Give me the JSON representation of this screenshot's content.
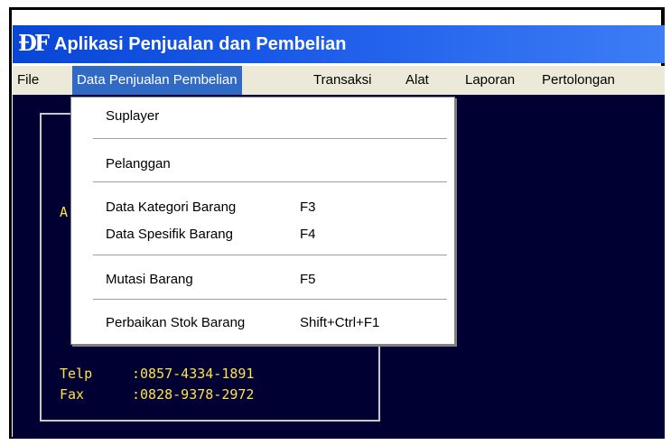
{
  "window": {
    "icon_glyph": "ÐF",
    "title": "Aplikasi Penjualan dan Pembelian"
  },
  "menubar": {
    "items": [
      {
        "label": "File"
      },
      {
        "label": "Data Penjualan Pembelian"
      },
      {
        "label": "Transaksi"
      },
      {
        "label": "Alat"
      },
      {
        "label": "Laporan"
      },
      {
        "label": "Pertolongan"
      }
    ],
    "active_index": 1
  },
  "dropdown": {
    "items": [
      {
        "label": "Suplayer",
        "shortcut": ""
      },
      {
        "label": "Pelanggan",
        "shortcut": ""
      },
      {
        "label": "Data Kategori Barang",
        "shortcut": "F3"
      },
      {
        "label": "Data Spesifik Barang",
        "shortcut": "F4"
      },
      {
        "label": "Mutasi Barang",
        "shortcut": "F5"
      },
      {
        "label": "Perbaikan Stok Barang",
        "shortcut": "Shift+Ctrl+F1"
      }
    ]
  },
  "info_panel": {
    "partial_text": "A",
    "telp_label": "Telp",
    "telp_value": ":0857-4334-1891",
    "fax_label": "Fax",
    "fax_value": ":0828-9378-2972"
  },
  "colors": {
    "titlebar": "#0846d6",
    "menu_highlight": "#316ac5",
    "desktop_bg": "#000033",
    "info_text": "#ffe14b"
  }
}
